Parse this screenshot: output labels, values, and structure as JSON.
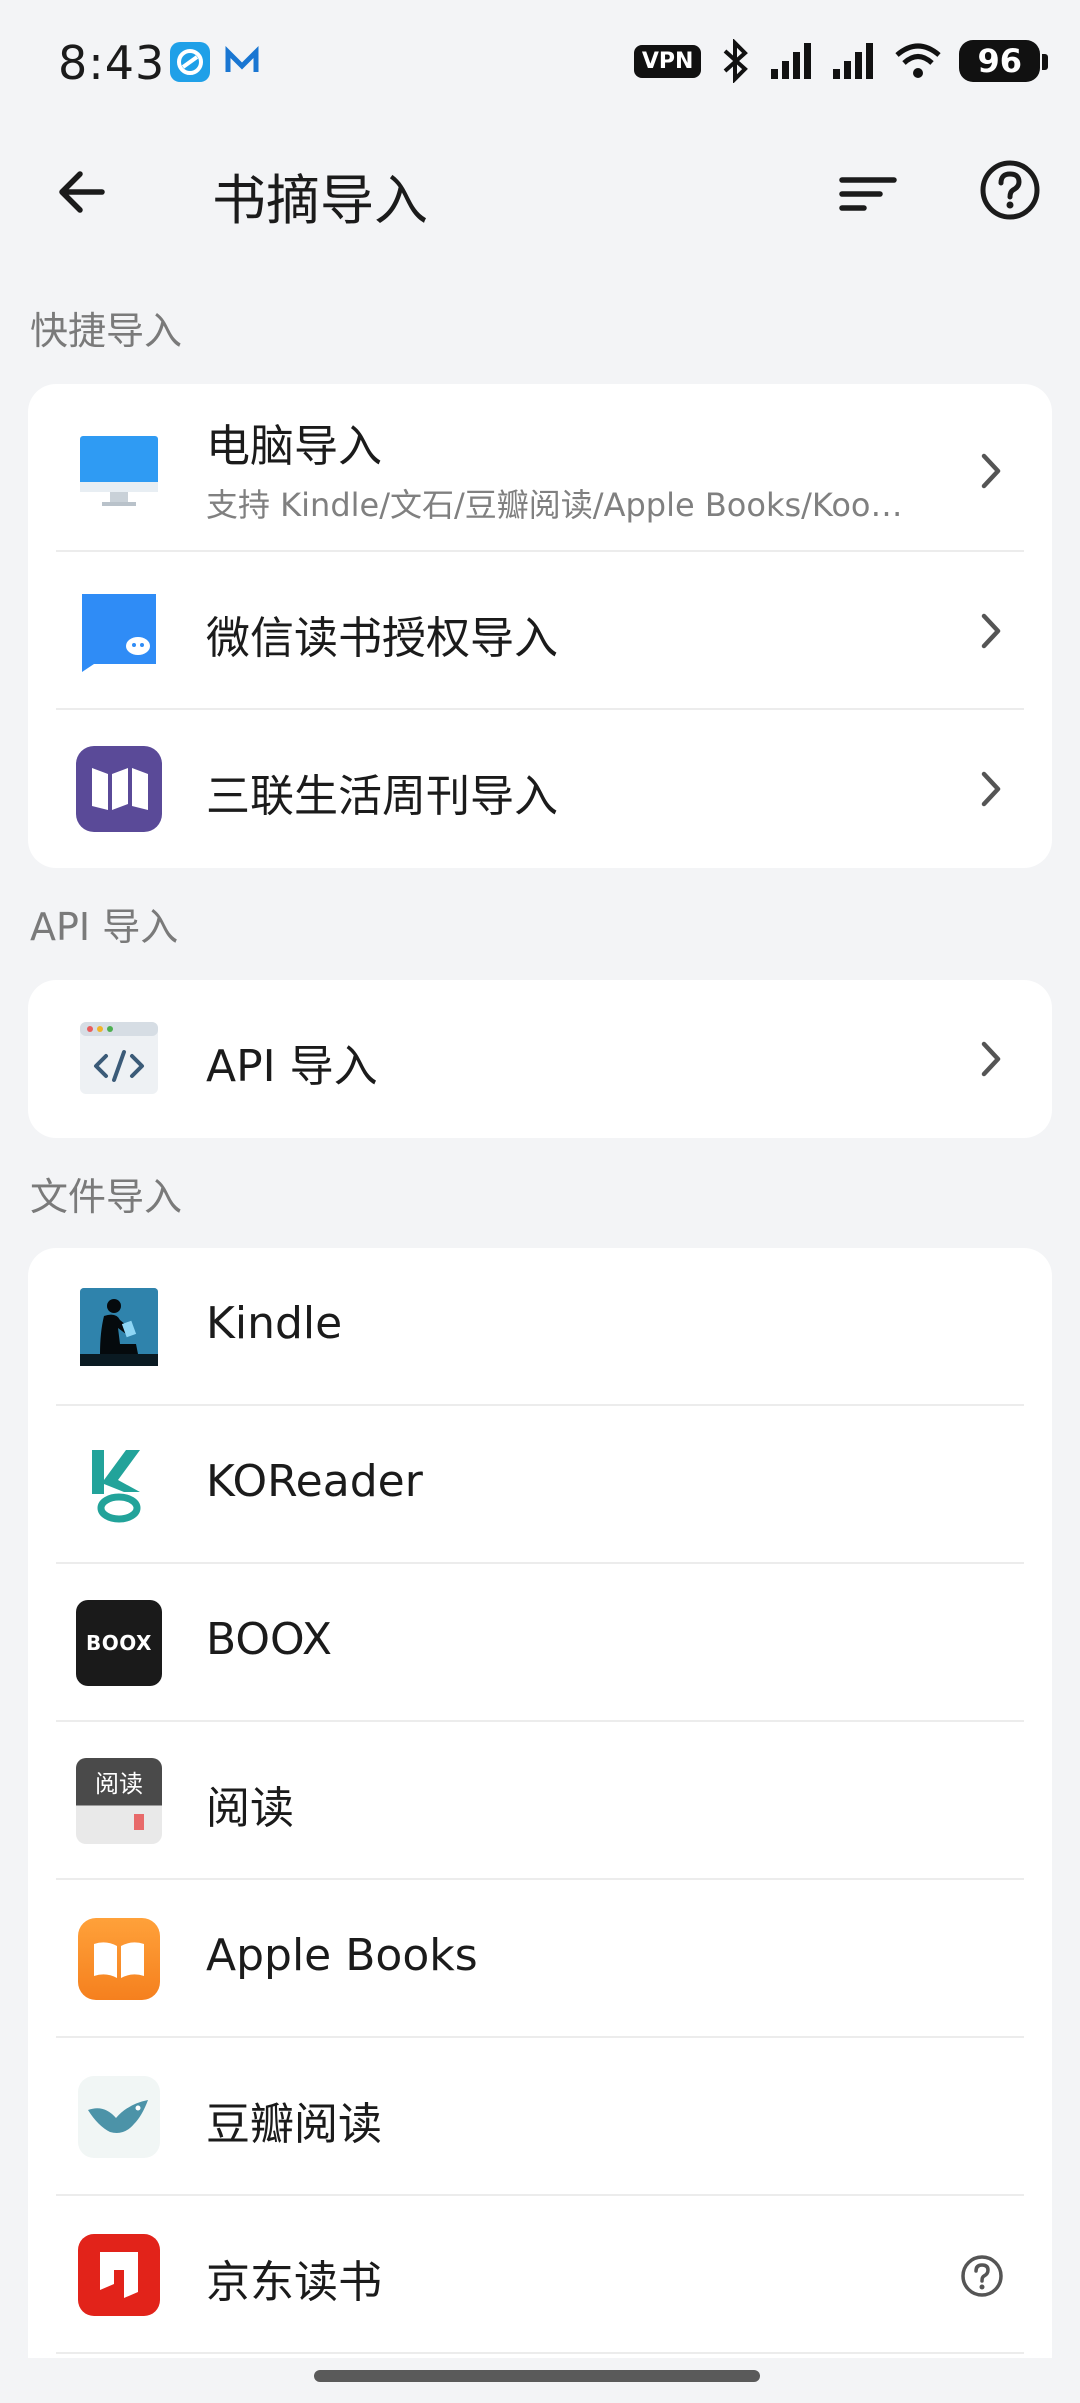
{
  "status_bar": {
    "time": "8:43",
    "vpn": "VPN",
    "battery": "96"
  },
  "header": {
    "title": "书摘导入"
  },
  "sections": {
    "quick": {
      "title": "快捷导入",
      "items": [
        {
          "label": "电脑导入",
          "subtitle": "支持 Kindle/文石/豆瓣阅读/Apple Books/Koo…"
        },
        {
          "label": "微信读书授权导入"
        },
        {
          "label": "三联生活周刊导入"
        }
      ]
    },
    "api": {
      "title": "API 导入",
      "items": [
        {
          "label": "API 导入"
        }
      ]
    },
    "file": {
      "title": "文件导入",
      "items": [
        {
          "label": "Kindle"
        },
        {
          "label": "KOReader"
        },
        {
          "label": "BOOX",
          "icon_text": "BOOX"
        },
        {
          "label": "阅读",
          "icon_text": "阅读"
        },
        {
          "label": "Apple Books"
        },
        {
          "label": "豆瓣阅读"
        },
        {
          "label": "京东读书"
        }
      ]
    }
  },
  "colors": {
    "background": "#f3f4f6",
    "card": "#ffffff",
    "accent_blue": "#2f8cf6",
    "sanlian_purple": "#5a4a98",
    "apple_books_orange": "#f7931e",
    "jd_red": "#e2231a"
  }
}
